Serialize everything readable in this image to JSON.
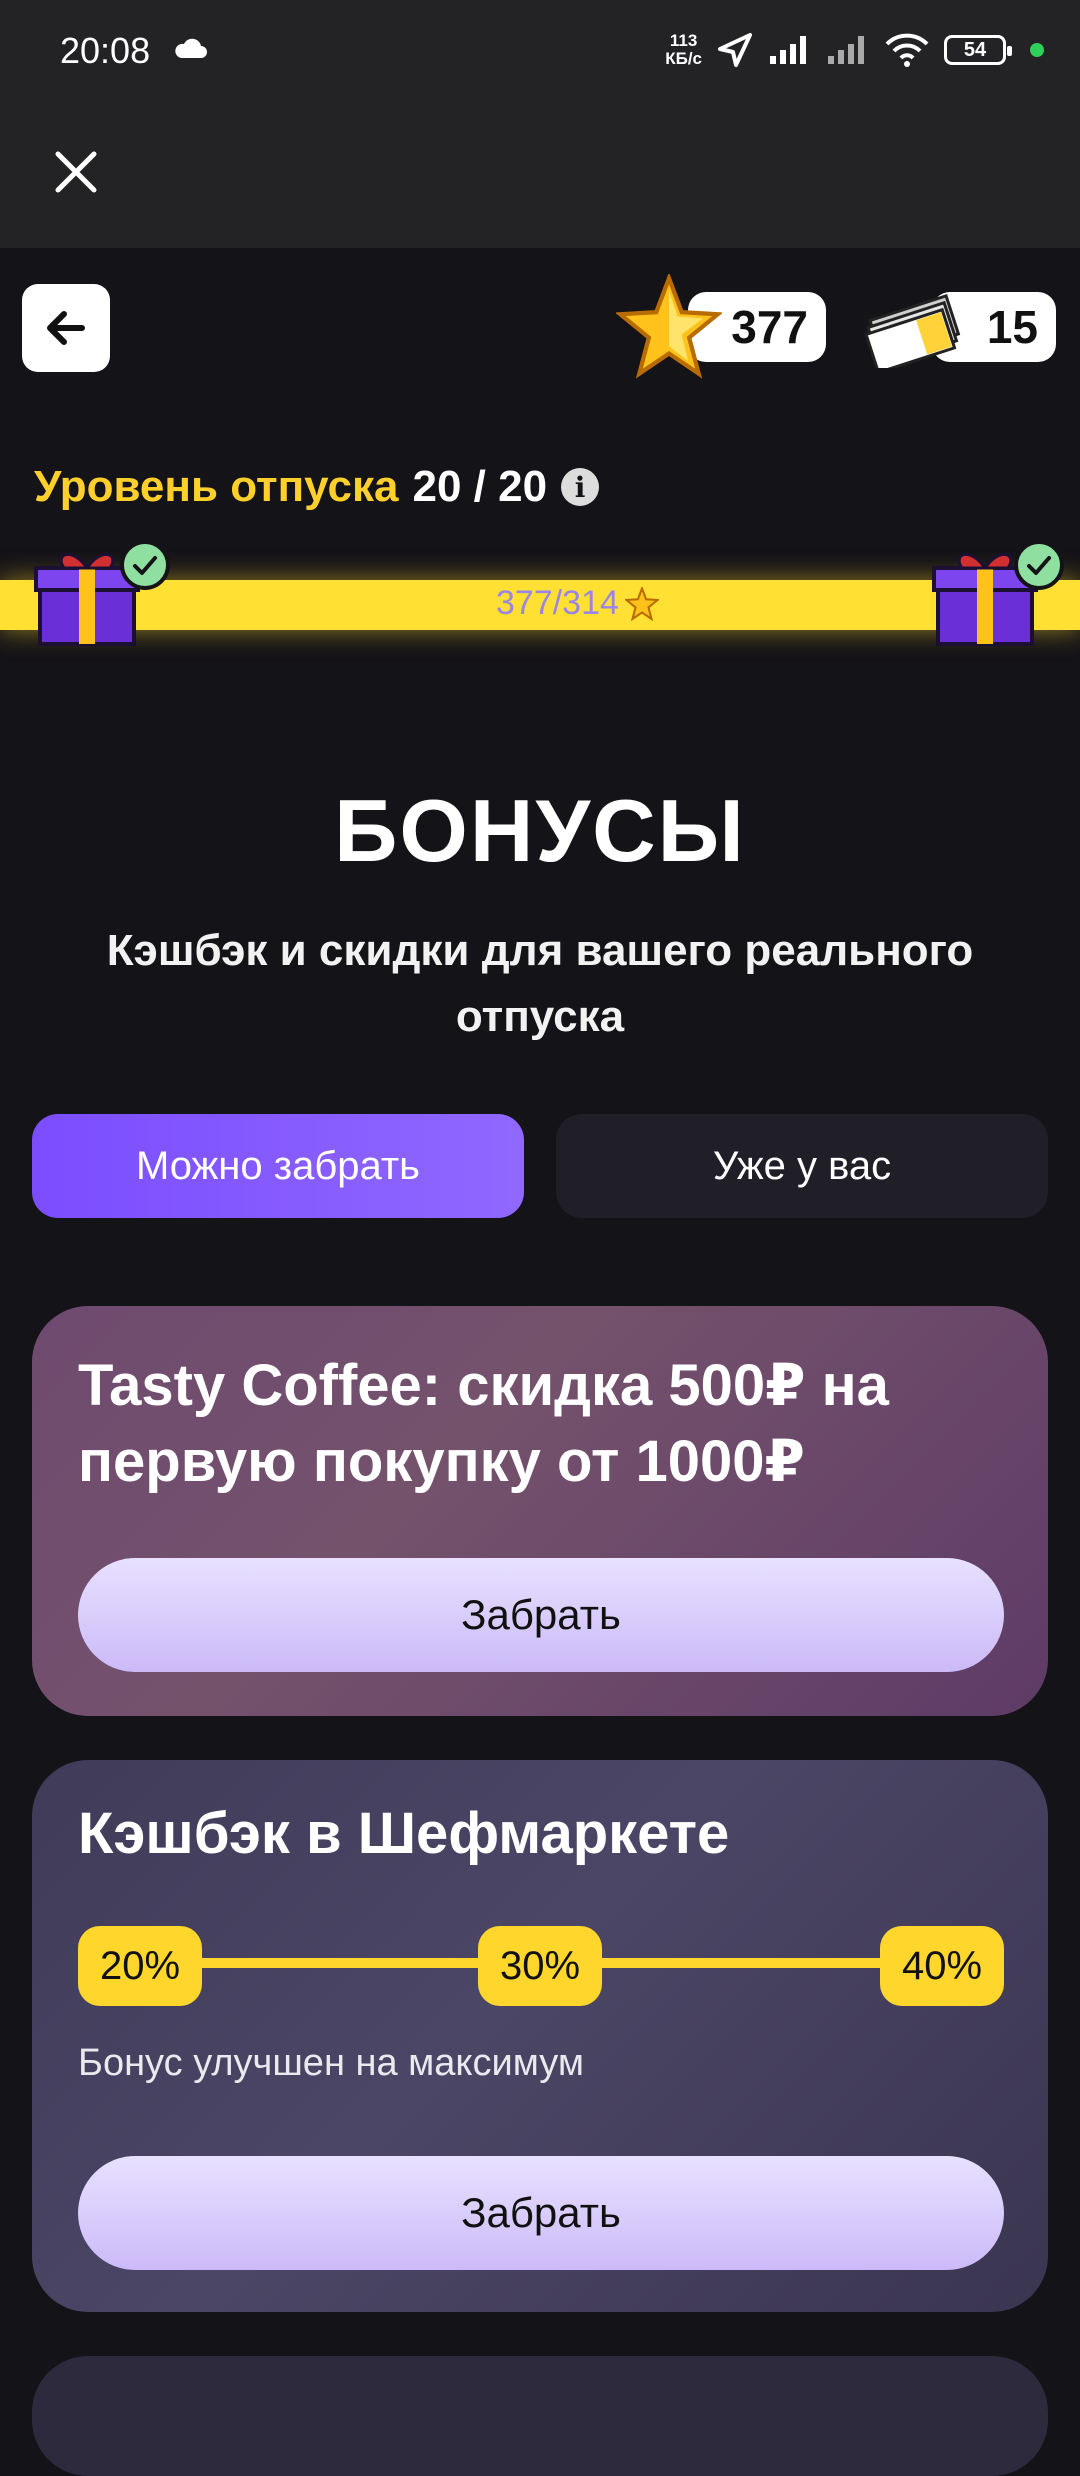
{
  "status_bar": {
    "time": "20:08",
    "speed_value": "113",
    "speed_unit": "КБ/с",
    "battery": "54"
  },
  "header": {
    "stars_count": "377",
    "tickets_count": "15"
  },
  "level": {
    "label": "Уровень отпуска",
    "value": "20 / 20",
    "progress_text": "377/314",
    "accent_color": "#ffd02b"
  },
  "page": {
    "title": "БОНУСЫ",
    "subtitle": "Кэшбэк и скидки для вашего реального отпуска"
  },
  "tabs": [
    {
      "label": "Можно забрать",
      "active": true
    },
    {
      "label": "Уже у вас",
      "active": false
    }
  ],
  "cards": [
    {
      "title": "Tasty Coffee: скидка 500₽ на первую покупку от 1000₽",
      "button_label": "Забрать"
    },
    {
      "title": "Кэшбэк в Шефмаркете",
      "tiers": [
        "20%",
        "30%",
        "40%"
      ],
      "note": "Бонус улучшен на максимум",
      "button_label": "Забрать"
    }
  ],
  "icons": [
    "cloud-icon",
    "location-arrow-icon",
    "signal-icon",
    "wifi-icon",
    "close-icon",
    "back-arrow-icon",
    "star-icon",
    "tickets-icon",
    "gift-icon",
    "check-icon",
    "info-icon"
  ]
}
